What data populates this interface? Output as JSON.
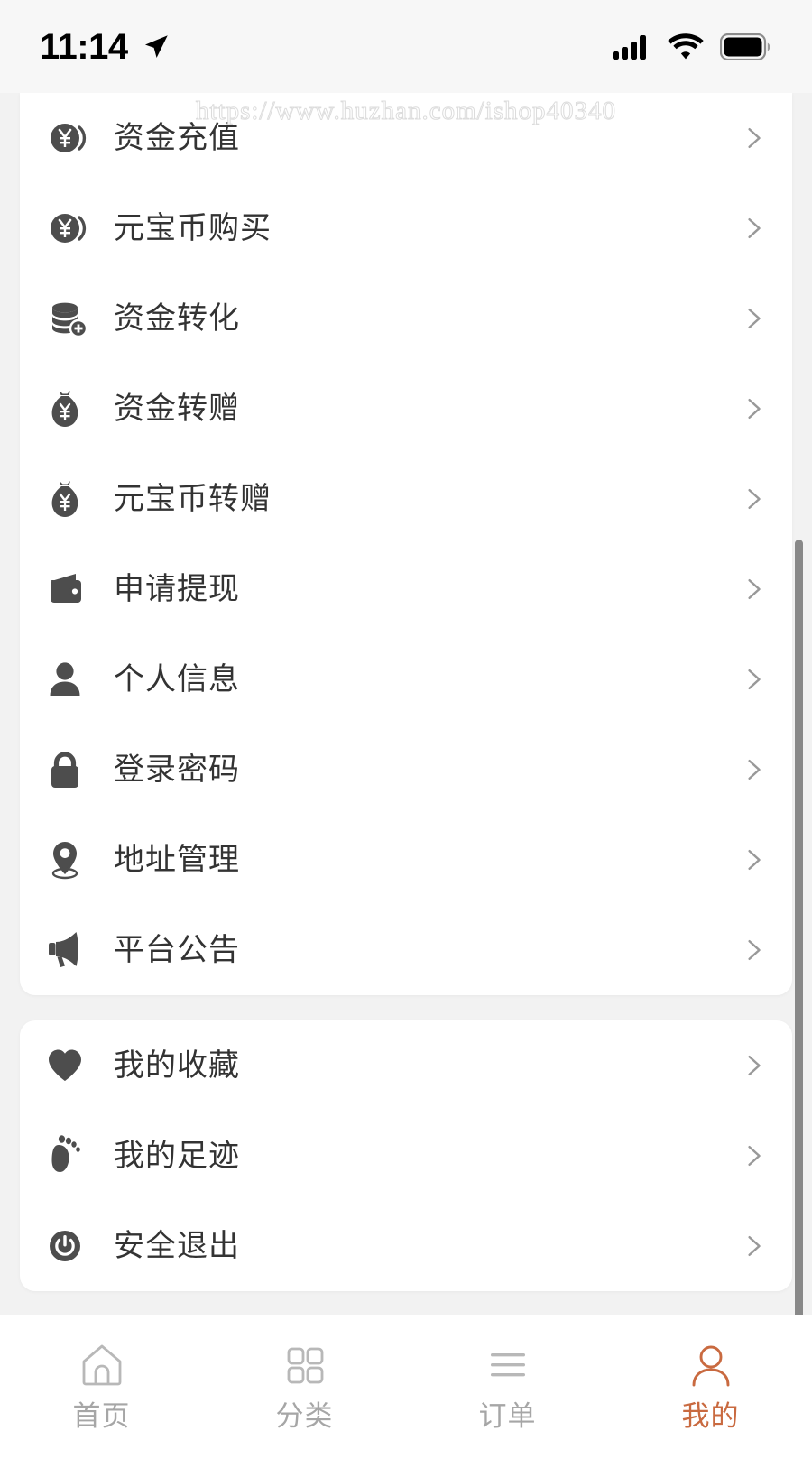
{
  "status_bar": {
    "time": "11:14",
    "location_icon": "location-arrow-icon",
    "signal_icon": "cellular-signal-icon",
    "wifi_icon": "wifi-icon",
    "battery_icon": "battery-full-icon"
  },
  "watermark": {
    "text": "https://www.huzhan.com/ishop40340"
  },
  "colors": {
    "page_background": "#f2f2f2",
    "card_background": "#ffffff",
    "label_text": "#333333",
    "icon_gray": "#4d4d4d",
    "chevron_gray": "#999999",
    "tab_inactive": "#a6a6a6",
    "tab_active": "#c96a40",
    "scrollbar": "#888888"
  },
  "cards": [
    {
      "name": "account-services-card",
      "items": [
        {
          "label": "资金充值",
          "icon": "coin-yen-icon",
          "chevron": "chevron-right-icon"
        },
        {
          "label": "元宝币购买",
          "icon": "coin-yen-icon",
          "chevron": "chevron-right-icon"
        },
        {
          "label": "资金转化",
          "icon": "coin-stack-plus-icon",
          "chevron": "chevron-right-icon"
        },
        {
          "label": "资金转赠",
          "icon": "money-bag-yen-icon",
          "chevron": "chevron-right-icon"
        },
        {
          "label": "元宝币转赠",
          "icon": "money-bag-yen-icon",
          "chevron": "chevron-right-icon"
        },
        {
          "label": "申请提现",
          "icon": "wallet-icon",
          "chevron": "chevron-right-icon"
        },
        {
          "label": "个人信息",
          "icon": "person-icon",
          "chevron": "chevron-right-icon"
        },
        {
          "label": "登录密码",
          "icon": "lock-icon",
          "chevron": "chevron-right-icon"
        },
        {
          "label": "地址管理",
          "icon": "map-pin-icon",
          "chevron": "chevron-right-icon"
        },
        {
          "label": "平台公告",
          "icon": "megaphone-icon",
          "chevron": "chevron-right-icon"
        }
      ]
    },
    {
      "name": "personal-card",
      "items": [
        {
          "label": "我的收藏",
          "icon": "heart-icon",
          "chevron": "chevron-right-icon"
        },
        {
          "label": "我的足迹",
          "icon": "footprint-icon",
          "chevron": "chevron-right-icon"
        },
        {
          "label": "安全退出",
          "icon": "power-icon",
          "chevron": "chevron-right-icon"
        }
      ]
    }
  ],
  "tabbar": {
    "tabs": [
      {
        "label": "首页",
        "icon": "home-icon",
        "active": false
      },
      {
        "label": "分类",
        "icon": "grid-icon",
        "active": false
      },
      {
        "label": "订单",
        "icon": "list-lines-icon",
        "active": false
      },
      {
        "label": "我的",
        "icon": "person-icon",
        "active": true
      }
    ]
  }
}
